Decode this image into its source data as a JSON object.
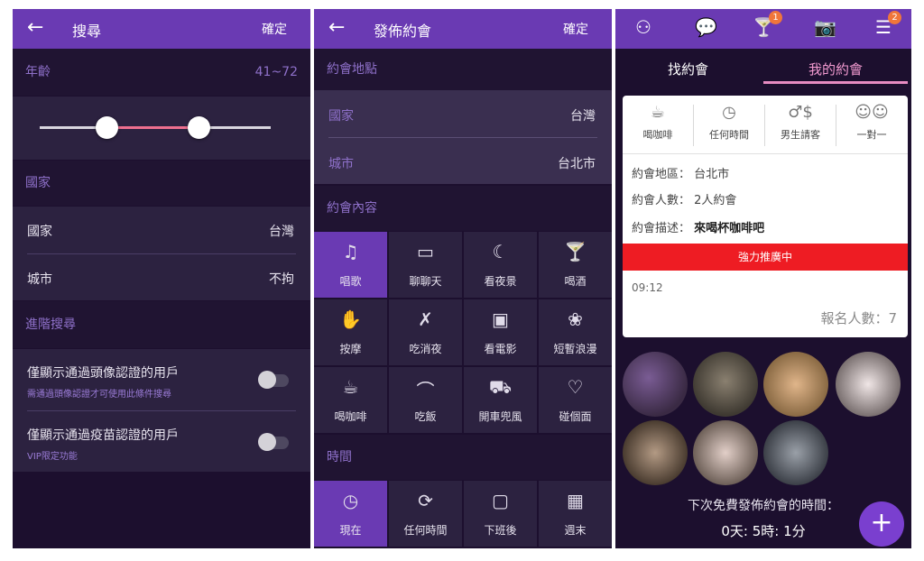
{
  "search_panel": {
    "title": "搜尋",
    "confirm": "確定",
    "age": {
      "label": "年齡",
      "range_text": "41~72",
      "min": 41,
      "max": 72
    },
    "country_section": "國家",
    "country_row": {
      "label": "國家",
      "value": "台灣"
    },
    "city_row": {
      "label": "城市",
      "value": "不拘"
    },
    "advanced_section": "進階搜尋",
    "filter_avatar": {
      "label": "僅顯示通過頭像認證的用戶",
      "hint": "需通過頭像認證才可使用此條件搜尋",
      "enabled": false
    },
    "filter_vaccine": {
      "label": "僅顯示通過疫苗認證的用戶",
      "hint": "VIP限定功能",
      "enabled": false
    }
  },
  "publish_panel": {
    "title": "發佈約會",
    "confirm": "確定",
    "location_section": "約會地點",
    "country_row": {
      "label": "國家",
      "value": "台灣"
    },
    "city_row": {
      "label": "城市",
      "value": "台北市"
    },
    "content_section": "約會內容",
    "activities": [
      {
        "label": "唱歌",
        "icon": "music-note-icon",
        "selected": true
      },
      {
        "label": "聊聊天",
        "icon": "laptop-icon",
        "selected": false
      },
      {
        "label": "看夜景",
        "icon": "moon-icon",
        "selected": false
      },
      {
        "label": "喝酒",
        "icon": "cocktail-icon",
        "selected": false
      },
      {
        "label": "按摩",
        "icon": "hands-icon",
        "selected": false
      },
      {
        "label": "吃消夜",
        "icon": "fork-knife-icon",
        "selected": false
      },
      {
        "label": "看電影",
        "icon": "movie-camera-icon",
        "selected": false
      },
      {
        "label": "短暫浪漫",
        "icon": "rose-icon",
        "selected": false
      },
      {
        "label": "喝咖啡",
        "icon": "coffee-cup-icon",
        "selected": false
      },
      {
        "label": "吃飯",
        "icon": "cloche-icon",
        "selected": false
      },
      {
        "label": "開車兜風",
        "icon": "car-icon",
        "selected": false
      },
      {
        "label": "碰個面",
        "icon": "heart-icon",
        "selected": false
      }
    ],
    "time_section": "時間",
    "times": [
      {
        "label": "現在",
        "icon": "clock-icon",
        "selected": true
      },
      {
        "label": "任何時間",
        "icon": "clock-arrow-icon",
        "selected": false
      },
      {
        "label": "下班後",
        "icon": "briefcase-icon",
        "selected": false
      },
      {
        "label": "週末",
        "icon": "calendar-icon",
        "selected": false
      }
    ]
  },
  "dates_panel": {
    "badges": {
      "cocktail": "1",
      "menu": "2"
    },
    "tab_find": "找約會",
    "tab_mine": "我的約會",
    "card": {
      "icons": [
        {
          "label": "喝咖啡",
          "icon": "coffee-cup-icon"
        },
        {
          "label": "任何時間",
          "icon": "clock-arrow-icon"
        },
        {
          "label": "男生請客",
          "icon": "man-dollar-icon"
        },
        {
          "label": "一對一",
          "icon": "two-faces-icon"
        }
      ],
      "area_label": "約會地區：",
      "area_value": "台北市",
      "people_label": "約會人數：",
      "people_value": "2人約會",
      "desc_label": "約會描述：",
      "desc_value": "來喝杯咖啡吧",
      "promo": "強力推廣中",
      "time": "09:12",
      "signup_count": "報名人數：7"
    },
    "next_label": "下次免費發佈約會的時間：",
    "next_value": "0天: 5時: 1分",
    "fab": "+"
  }
}
